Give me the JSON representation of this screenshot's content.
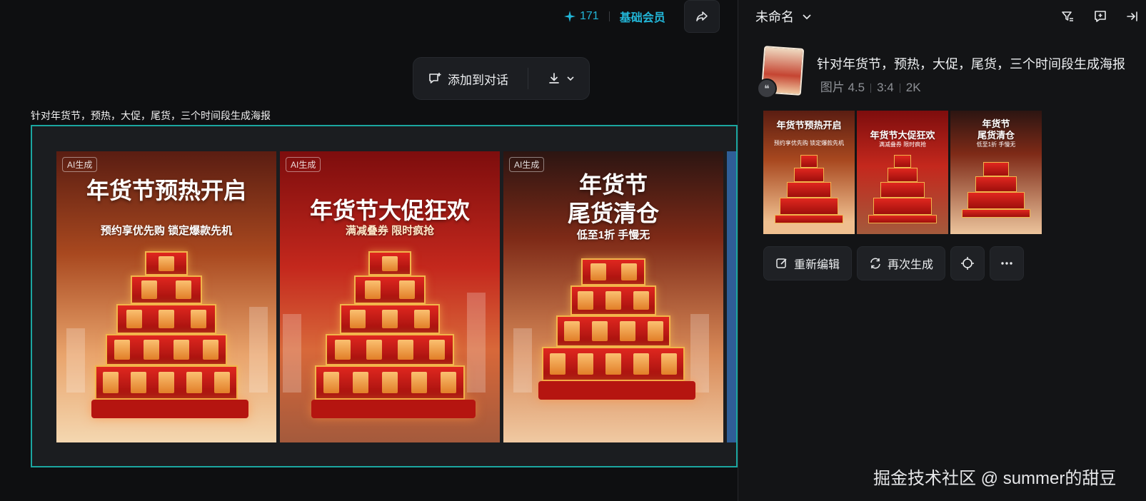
{
  "header": {
    "credits_icon": "sparkle-icon",
    "credits": "171",
    "membership": "基础会员",
    "share_icon": "share-icon"
  },
  "toolbar": {
    "add_to_chat": "添加到对话",
    "download_icon": "download-icon"
  },
  "canvas": {
    "caption": "针对年货节，预热，大促，尾货，三个时间段生成海报",
    "posters": [
      {
        "badge": "AI生成",
        "title": "年货节预热开启",
        "subtitle": "预约享优先购 锁定爆款先机"
      },
      {
        "badge": "AI生成",
        "title": "年货节大促狂欢",
        "subtitle": "满减叠券 限时疯抢"
      },
      {
        "badge": "AI生成",
        "title_line1": "年货节",
        "title_line2": "尾货清仓",
        "subtitle": "低至1折 手慢无"
      }
    ]
  },
  "panel": {
    "title": "未命名",
    "prompt": "针对年货节，预热，大促，尾货，三个时间段生成海报",
    "model": "图片 4.5",
    "ratio": "3:4",
    "resolution": "2K",
    "thumbnails": [
      {
        "title": "年货节预热开启",
        "subtitle": "预约享优先购 锁定爆款先机"
      },
      {
        "title": "年货节大促狂欢",
        "subtitle": "满减叠券 限时疯抢"
      },
      {
        "title_line1": "年货节",
        "title_line2": "尾货清仓",
        "subtitle": "低至1折 手慢无"
      }
    ],
    "actions": {
      "re_edit": "重新编辑",
      "regenerate": "再次生成"
    }
  },
  "watermark": "掘金技术社区 @ summer的甜豆",
  "colors": {
    "accent": "#22b6d8",
    "selection": "#1ba6a0",
    "poster_red": "#c4281d"
  }
}
